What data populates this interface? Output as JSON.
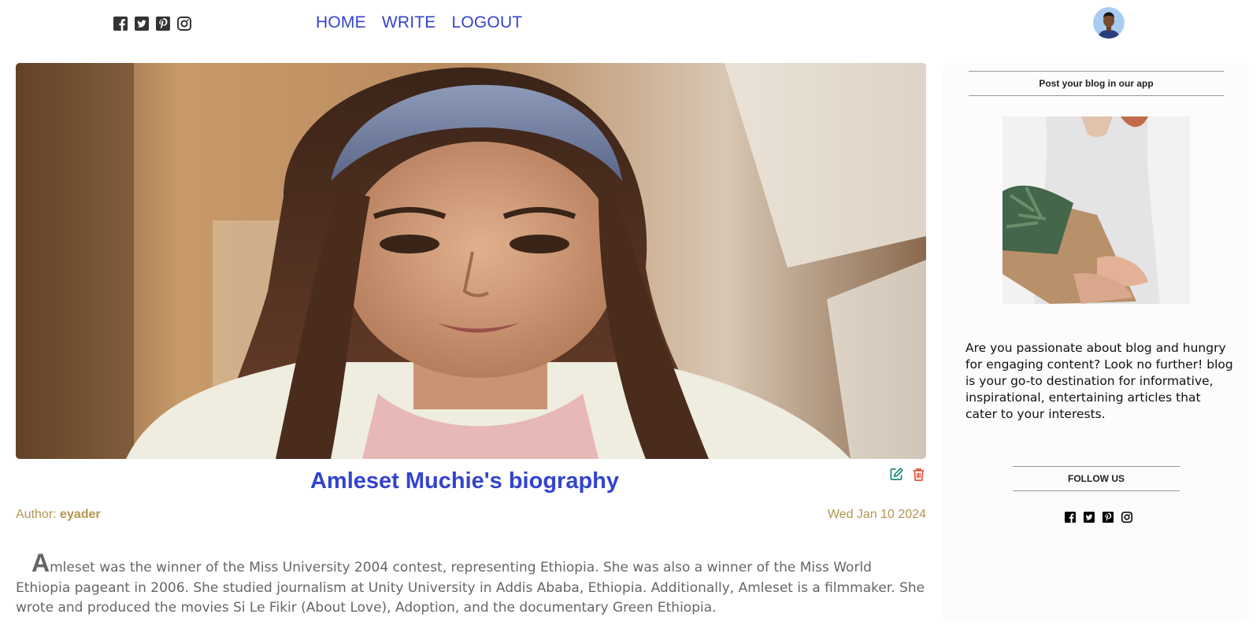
{
  "top_social": {
    "icons": [
      "facebook-square-icon",
      "twitter-square-icon",
      "pinterest-square-icon",
      "instagram-icon"
    ]
  },
  "nav": {
    "home": "HOME",
    "write": "WRITE",
    "logout": "LOGOUT"
  },
  "post": {
    "title": "Amleset Muchie's biography",
    "author_label": "Author:",
    "author_name": "eyader",
    "date": "Wed Jan 10 2024",
    "body_first_letter": "A",
    "body_rest": "mleset was the winner of the Miss University 2004 contest, representing Ethiopia. She was also a winner of the Miss World Ethiopia pageant in 2006. She studied journalism at Unity University in Addis Ababa, Ethiopia. Additionally, Amleset is a filmmaker. She wrote and produced the movies Si Le Fikir (About Love), Adoption, and the documentary Green Ethiopia."
  },
  "sidebar": {
    "about_title": "Post your blog in our app",
    "about_text": "Are you passionate about blog and hungry for engaging content? Look no further! blog is your go-to destination for informative, inspirational, entertaining articles that cater to your interests.",
    "follow_title": "FOLLOW US"
  },
  "colors": {
    "nav_link": "#3344cc",
    "title": "#3344cc",
    "meta": "#b39650",
    "edit_icon": "#1a8a7a",
    "delete_icon": "#e0563c"
  }
}
